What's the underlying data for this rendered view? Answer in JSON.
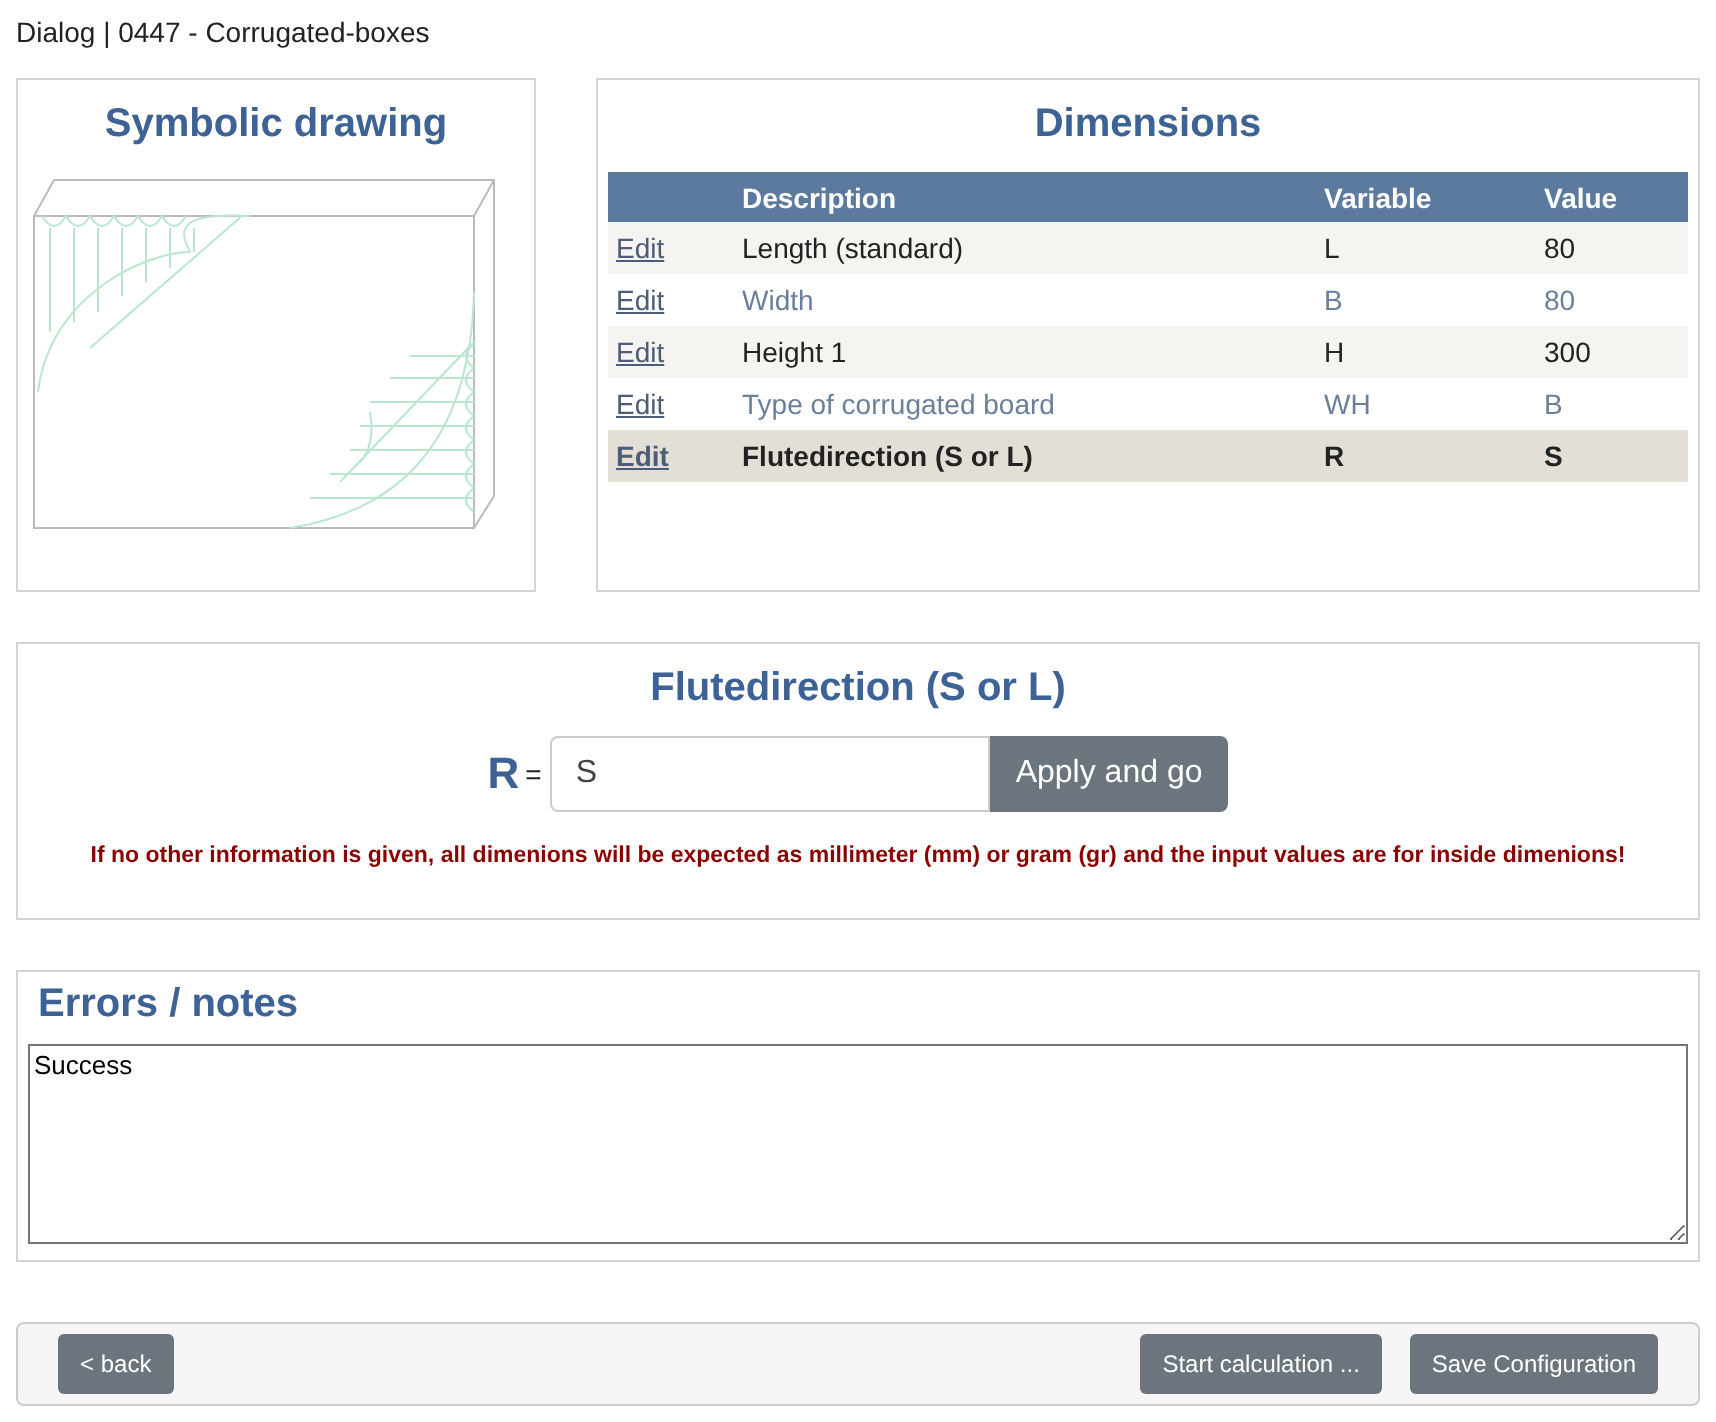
{
  "window": {
    "title": "Dialog | 0447 - Corrugated-boxes"
  },
  "drawing_panel": {
    "title": "Symbolic drawing"
  },
  "dimensions": {
    "title": "Dimensions",
    "columns": [
      "Description",
      "Variable",
      "Value"
    ],
    "rows": [
      {
        "action": "Edit",
        "description": "Length (standard)",
        "variable": "L",
        "value": "80",
        "selected": false
      },
      {
        "action": "Edit",
        "description": "Width",
        "variable": "B",
        "value": "80",
        "selected": false
      },
      {
        "action": "Edit",
        "description": "Height 1",
        "variable": "H",
        "value": "300",
        "selected": false
      },
      {
        "action": "Edit",
        "description": "Type of corrugated board",
        "variable": "WH",
        "value": "B",
        "selected": false
      },
      {
        "action": "Edit",
        "description": "Flutedirection (S or L)",
        "variable": "R",
        "value": "S",
        "selected": true
      }
    ]
  },
  "editor": {
    "title": "Flutedirection (S or L)",
    "variable": "R",
    "equals": "=",
    "value": "S",
    "button": "Apply and go",
    "notice": "If no other information is given, all dimenions will be expected as millimeter (mm) or gram (gr) and the input values are for inside dimenions!"
  },
  "notes": {
    "title": "Errors / notes",
    "text": "Success"
  },
  "footer": {
    "back": "< back",
    "buttons": [
      "Start calculation ...",
      "Save Configuration"
    ]
  }
}
